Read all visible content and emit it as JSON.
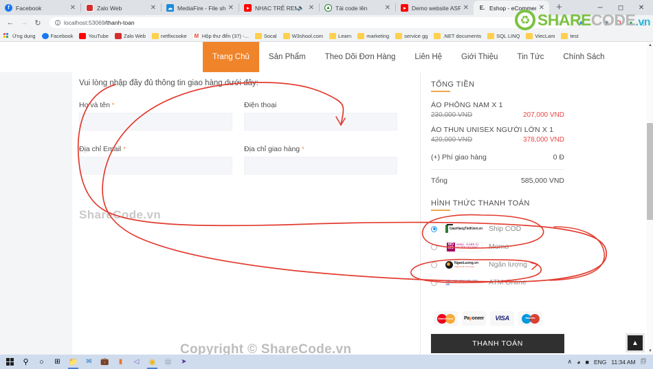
{
  "browser": {
    "tabs": [
      {
        "title": "Facebook",
        "icon": "facebook-icon",
        "active": false,
        "muted": false
      },
      {
        "title": "Zalo Web",
        "icon": "zalo-icon",
        "active": false,
        "muted": false
      },
      {
        "title": "MediaFire - File sharing",
        "icon": "mediafire-icon",
        "active": false,
        "muted": false
      },
      {
        "title": "NHẠC TRẺ REMIX",
        "icon": "youtube-icon",
        "active": false,
        "muted": true
      },
      {
        "title": "Tải code lên",
        "icon": "upload-icon",
        "active": false,
        "muted": false
      },
      {
        "title": "Demo website ASP. NE",
        "icon": "youtube-icon",
        "active": false,
        "muted": false
      },
      {
        "title": "Eshop - eCommerce H",
        "icon": "eshop-icon",
        "active": true,
        "muted": false
      }
    ],
    "new_tab_label": "+",
    "window_controls": {
      "minimize": "─",
      "maximize": "⬜",
      "close": "✕"
    },
    "toolbar": {
      "back": "←",
      "forward": "→",
      "reload": "↻",
      "url_host": "localhost:53069",
      "url_path": "/thanh-toan",
      "star": "☆",
      "profile_initial": "O"
    },
    "bookmarks": [
      {
        "label": "Ứng dụng",
        "icon": "apps-grid-icon"
      },
      {
        "label": "Facebook",
        "icon": "facebook-icon"
      },
      {
        "label": "YouTube",
        "icon": "youtube-icon"
      },
      {
        "label": "Zalo Web",
        "icon": "zalo-icon"
      },
      {
        "label": "netfixcooke",
        "icon": "folder-icon"
      },
      {
        "label": "Hộp thư đến (37) -...",
        "icon": "gmail-icon"
      },
      {
        "label": "Socal",
        "icon": "folder-icon"
      },
      {
        "label": "W3shool.com",
        "icon": "folder-icon"
      },
      {
        "label": "Learn",
        "icon": "folder-icon"
      },
      {
        "label": "marketing",
        "icon": "folder-icon"
      },
      {
        "label": "service gg",
        "icon": "folder-icon"
      },
      {
        "label": ".NET documents",
        "icon": "folder-icon"
      },
      {
        "label": "SQL LINQ",
        "icon": "folder-icon"
      },
      {
        "label": "ViecLam",
        "icon": "folder-icon"
      },
      {
        "label": "test",
        "icon": "folder-icon"
      }
    ]
  },
  "watermark": {
    "logo_share": "SHARE",
    "logo_code": "CODE",
    "logo_vn": ".vn",
    "page_mark": "ShareCode.vn",
    "copyright": "Copyright © ShareCode.vn"
  },
  "site": {
    "nav": [
      {
        "label": "Trang Chủ",
        "active": true
      },
      {
        "label": "Sản Phẩm",
        "active": false
      },
      {
        "label": "Theo Dõi Đơn Hàng",
        "active": false
      },
      {
        "label": "Liên Hệ",
        "active": false
      },
      {
        "label": "Giới Thiệu",
        "active": false
      },
      {
        "label": "Tin Tức",
        "active": false
      },
      {
        "label": "Chính Sách",
        "active": false
      }
    ]
  },
  "form": {
    "intro": "Vui lòng nhập đầy đủ thông tin giao hàng dưới đây:",
    "fields": [
      {
        "label": "Họ và tên",
        "required": "*",
        "value": "",
        "placeholder": ""
      },
      {
        "label": "Điện thoại",
        "required": "",
        "value": "",
        "placeholder": ""
      },
      {
        "label": "Địa chỉ Email",
        "required": "*",
        "value": "",
        "placeholder": ""
      },
      {
        "label": "Địa chỉ giao hàng",
        "required": "*",
        "value": "",
        "placeholder": ""
      }
    ]
  },
  "summary": {
    "title": "TỔNG TIỀN",
    "items": [
      {
        "name": "ÁO PHÔNG NAM X 1",
        "old_price": "230,000 VND",
        "new_price": "207,000 VND"
      },
      {
        "name": "ÁO THUN UNISEX NGƯỜI LỚN X 1",
        "old_price": "420,000 VND",
        "new_price": "378,000 VND"
      }
    ],
    "shipping_label": "(+) Phí giao hàng",
    "shipping_value": "0 Đ",
    "total_label": "Tổng",
    "total_value": "585,000 VND"
  },
  "payment": {
    "title": "HÌNH THỨC THANH TOÁN",
    "methods": [
      {
        "label": "Ship COD",
        "logo": "giaohangtietkiem-logo",
        "selected": true
      },
      {
        "label": "Momo",
        "logo": "momo-logo",
        "selected": false
      },
      {
        "label": "Ngân lượng",
        "logo": "nganluong-logo",
        "selected": false
      },
      {
        "label": "ATM Online",
        "logo": "atm-banks-logo",
        "selected": false
      }
    ],
    "cards": [
      {
        "name": "mastercard-logo",
        "text": "MasterCard"
      },
      {
        "name": "payoneer-logo",
        "text": "Payoneer"
      },
      {
        "name": "visa-logo",
        "text": "VISA"
      },
      {
        "name": "maestro-logo",
        "text": "Maestro"
      }
    ],
    "checkout_label": "THANH TOÁN"
  },
  "annotation": {
    "note": "Hand-drawn red ink circles over the delivery form area and over the Ship COD / Ngân lượng payment options",
    "color": "#e23b2e"
  },
  "taskbar": {
    "items": [
      {
        "name": "start-button",
        "icon": "windows-icon"
      },
      {
        "name": "search-button",
        "icon": "search-icon"
      },
      {
        "name": "cortana-button",
        "icon": "circle-icon"
      },
      {
        "name": "task-view-button",
        "icon": "task-view-icon"
      },
      {
        "name": "file-explorer",
        "icon": "folder-icon",
        "running": true
      },
      {
        "name": "mail-app",
        "icon": "mail-icon"
      },
      {
        "name": "store-app",
        "icon": "store-icon"
      },
      {
        "name": "sublime-app",
        "icon": "sublime-icon"
      },
      {
        "name": "vscode-insiders",
        "icon": "vscode-icon"
      },
      {
        "name": "chrome-app",
        "icon": "chrome-icon",
        "running": true
      },
      {
        "name": "sql-app",
        "icon": "sql-icon"
      },
      {
        "name": "visual-studio-app",
        "icon": "visual-studio-icon"
      }
    ],
    "tray": {
      "show_hidden": "∧",
      "network": "wifi-icon",
      "battery": "battery-icon",
      "language": "ENG",
      "clock": "11:34 AM",
      "notifications": "notification-icon"
    }
  },
  "scroll": {
    "to_top_label": "▲",
    "up_arrow": "▲",
    "down_arrow": "▼"
  }
}
